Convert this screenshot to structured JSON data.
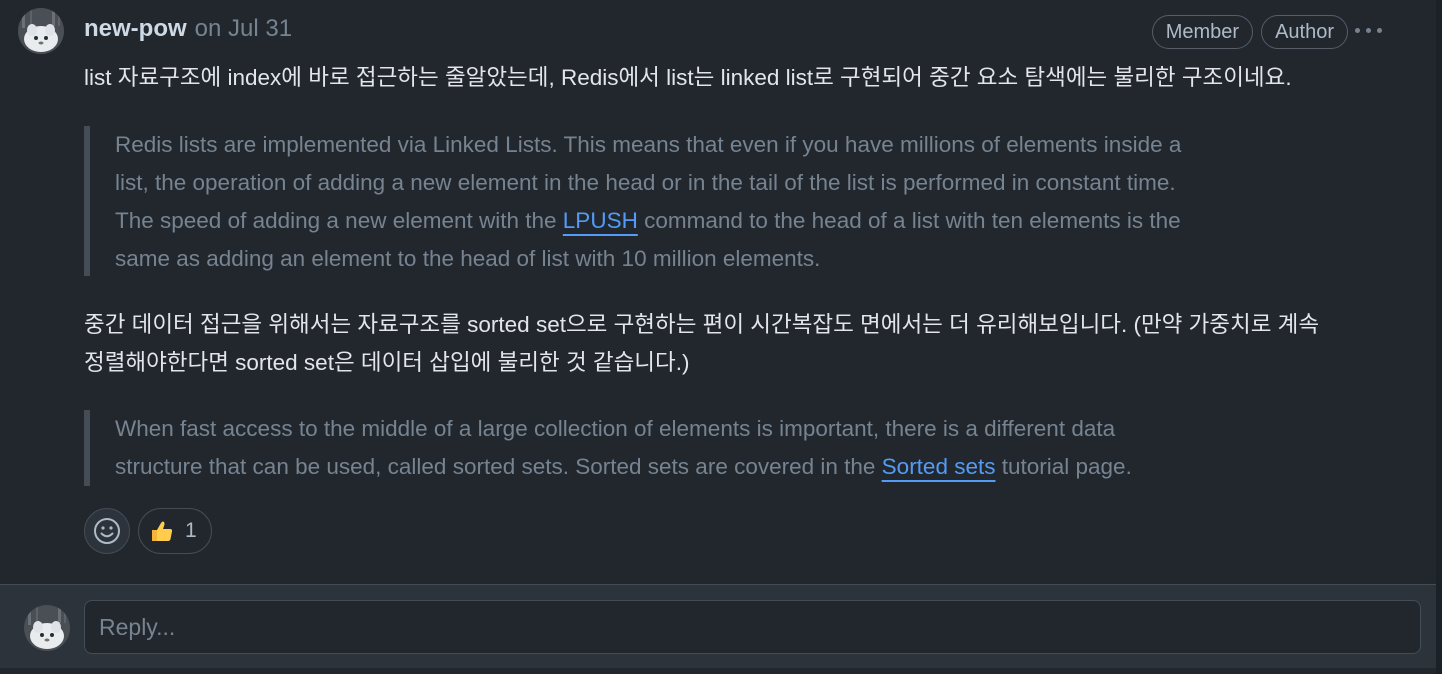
{
  "comment": {
    "author": "new-pow",
    "date": "on Jul 31",
    "badges": [
      "Member",
      "Author"
    ],
    "paragraph1": "list 자료구조에 index에 바로 접근하는 줄알았는데, Redis에서 list는 linked list로 구현되어 중간 요소 탐색에는 불리한 구조이네요.",
    "quote1": {
      "line1": "Redis lists are implemented via Linked Lists. This means that even if you have millions of elements inside a",
      "line2": "list, the operation of adding a new element in the head or in the tail of the list is performed in constant time.",
      "line3_before": "The speed of adding a new element with the ",
      "line3_link": "LPUSH",
      "line3_after": " command to the head of a list with ten elements is the",
      "line4": "same as adding an element to the head of list with 10 million elements."
    },
    "paragraph2": {
      "line1": "중간 데이터 접근을 위해서는 자료구조를 sorted set으로 구현하는 편이 시간복잡도 면에서는 더 유리해보입니다. (만약 가중치로 계속",
      "line2": "정렬해야한다면 sorted set은 데이터 삽입에 불리한 것 같습니다.)"
    },
    "quote2": {
      "line1": "When fast access to the middle of a large collection of elements is important, there is a different data",
      "line2_before": "structure that can be used, called sorted sets. Sorted sets are covered in the ",
      "line2_link": "Sorted sets",
      "line2_after": " tutorial page."
    },
    "reactions": [
      {
        "icon": "thumbs-up-icon",
        "count": "1"
      }
    ]
  },
  "reply": {
    "placeholder": "Reply..."
  },
  "colors": {
    "background": "#22272e",
    "link": "#539bf5",
    "muted": "#768390",
    "border": "#444c56"
  }
}
